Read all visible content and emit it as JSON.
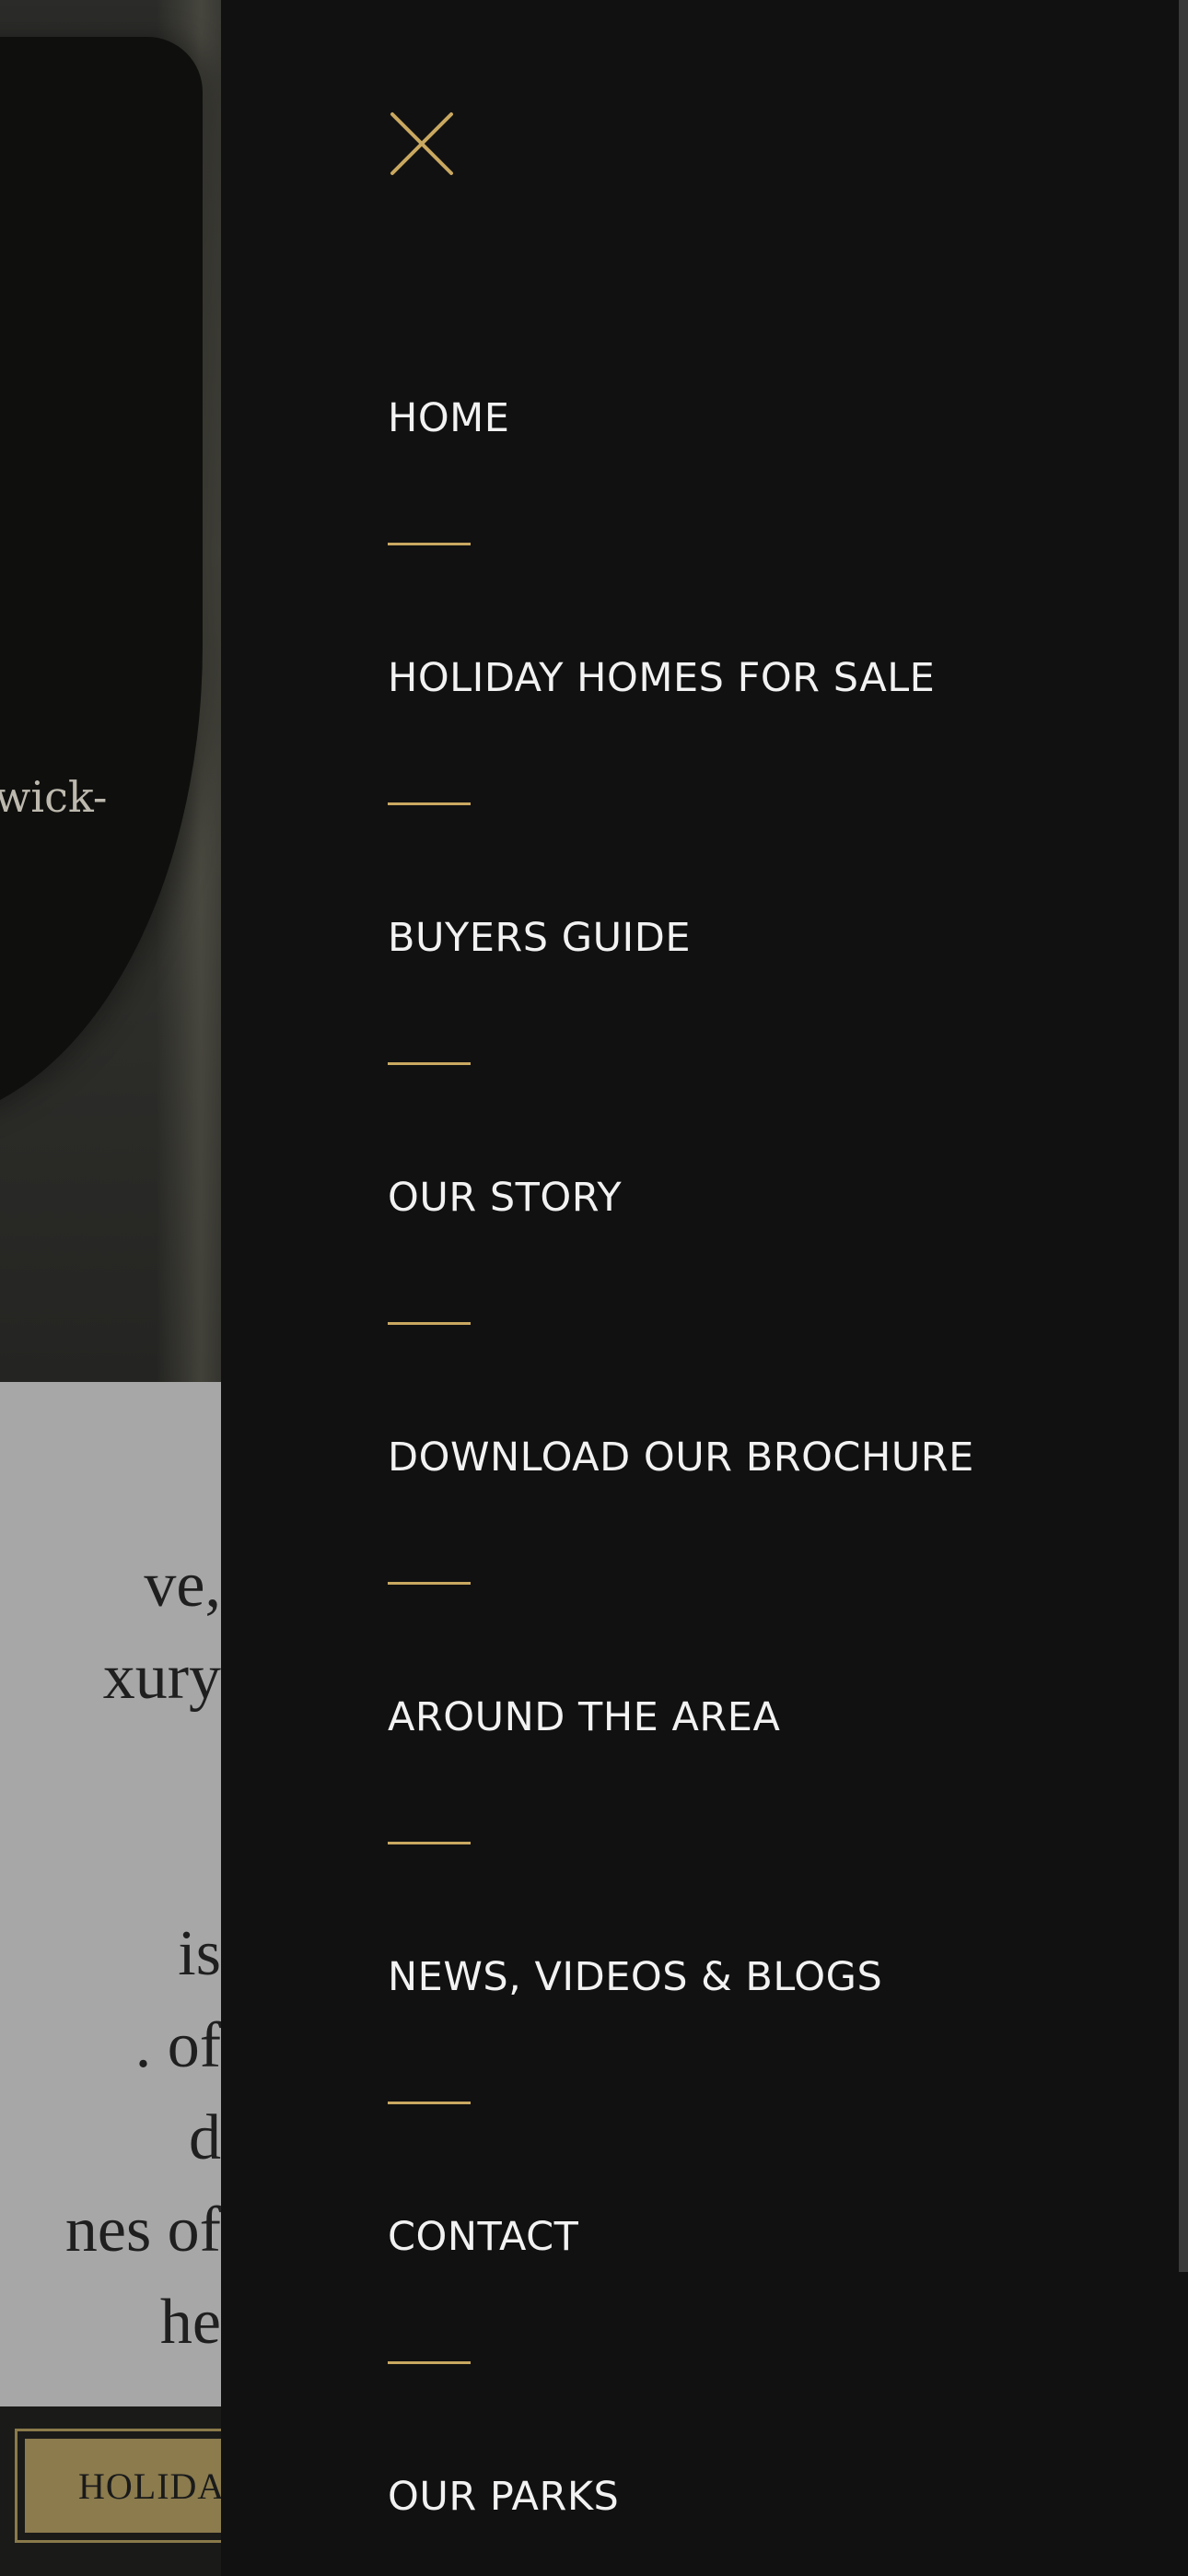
{
  "theme": {
    "panel_bg": "#111112",
    "accent": "#c9a860",
    "menu_text": "#f2f2f2"
  },
  "background_page": {
    "hero_caption": "wick-",
    "text_lines": [
      "",
      "ve,",
      "xury",
      "",
      " is",
      ". of",
      "d",
      "nes of",
      "he"
    ],
    "bottom_button_label": "HOLIDAY"
  },
  "menu": {
    "close_icon": "close-icon",
    "items": [
      {
        "label": "HOME"
      },
      {
        "label": "HOLIDAY HOMES FOR SALE"
      },
      {
        "label": "BUYERS GUIDE"
      },
      {
        "label": "OUR STORY"
      },
      {
        "label": "DOWNLOAD OUR BROCHURE"
      },
      {
        "label": "AROUND THE AREA"
      },
      {
        "label": "NEWS, VIDEOS & BLOGS"
      },
      {
        "label": "CONTACT"
      },
      {
        "label": "OUR PARKS"
      }
    ]
  }
}
